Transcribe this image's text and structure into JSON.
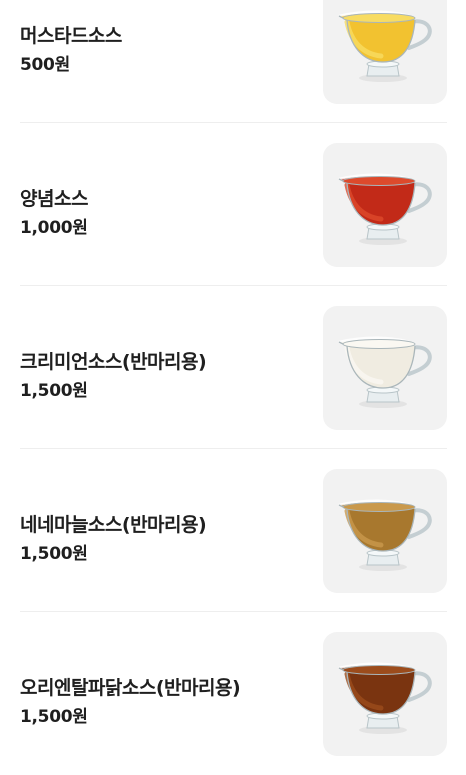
{
  "menu": {
    "items": [
      {
        "name": "머스타드소스",
        "price": "500원",
        "image": "sauce-boat",
        "sauce_color": "#f2c230",
        "sauce_light": "#f8dc62"
      },
      {
        "name": "양념소스",
        "price": "1,000원",
        "image": "sauce-boat",
        "sauce_color": "#c22a18",
        "sauce_light": "#dd4a2c"
      },
      {
        "name": "크리미언소스(반마리용)",
        "price": "1,500원",
        "image": "sauce-boat",
        "sauce_color": "#f0ece1",
        "sauce_light": "#faf8f2"
      },
      {
        "name": "네네마늘소스(반마리용)",
        "price": "1,500원",
        "image": "sauce-boat",
        "sauce_color": "#a8782e",
        "sauce_light": "#c9994c"
      },
      {
        "name": "오리엔탈파닭소스(반마리용)",
        "price": "1,500원",
        "image": "sauce-boat",
        "sauce_color": "#7a3410",
        "sauce_light": "#9c4c1c"
      }
    ]
  }
}
